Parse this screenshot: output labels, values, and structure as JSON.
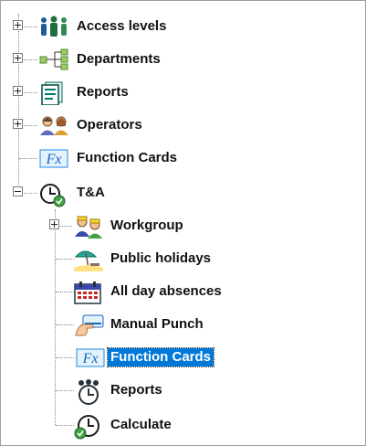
{
  "tree": {
    "root_items": [
      {
        "label": "Access levels",
        "icon": "people-icon"
      },
      {
        "label": "Departments",
        "icon": "hierarchy-icon"
      },
      {
        "label": "Reports",
        "icon": "report-icon"
      },
      {
        "label": "Operators",
        "icon": "operators-icon"
      },
      {
        "label": "Function Cards",
        "icon": "function-fx-icon"
      },
      {
        "label": "T&A",
        "icon": "clock-icon"
      }
    ],
    "ta_children": [
      {
        "label": "Workgroup",
        "icon": "workgroup-icon"
      },
      {
        "label": "Public holidays",
        "icon": "beach-icon"
      },
      {
        "label": "All day absences",
        "icon": "calendar-icon"
      },
      {
        "label": "Manual Punch",
        "icon": "hand-card-icon"
      },
      {
        "label": "Function Cards",
        "icon": "function-fx-icon",
        "selected": true
      },
      {
        "label": "Reports",
        "icon": "team-clock-icon"
      },
      {
        "label": "Calculate",
        "icon": "calculate-clock-icon"
      }
    ]
  },
  "colors": {
    "selection": "#0078d7",
    "line": "#888888"
  }
}
